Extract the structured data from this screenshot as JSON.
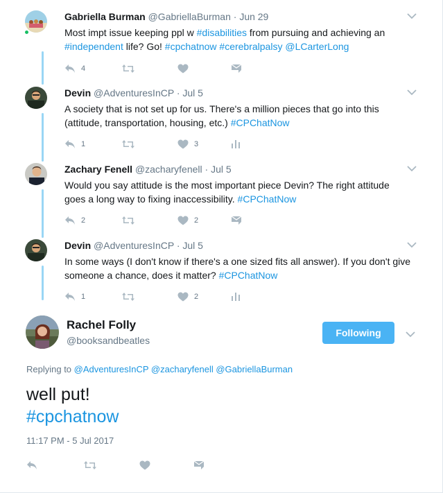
{
  "tweets": [
    {
      "name": "Gabriella Burman",
      "handle": "@GabriellaBurman",
      "dot": "·",
      "time": "Jun 29",
      "text": {
        "p1": "Most impt issue keeping ppl w ",
        "h1": "#disabilities",
        "p2": " from pursuing and achieving an ",
        "h2": "#independent",
        "p3": " life? Go! ",
        "h3": "#cpchatnow",
        "p4": " ",
        "h4": "#cerebralpalsy",
        "p5": " ",
        "h5": "@LCarterLong"
      },
      "reply_count": "4",
      "like_count": "",
      "last_action": "dm-icon"
    },
    {
      "name": "Devin",
      "handle": "@AdventuresInCP",
      "dot": "·",
      "time": "Jul 5",
      "text": {
        "p1": "A society that is not set up for us. There's a million pieces that go into this (attitude, transportation, housing, etc.) ",
        "h1": "#CPChatNow"
      },
      "reply_count": "1",
      "like_count": "3",
      "last_action": "analytics-icon"
    },
    {
      "name": "Zachary Fenell",
      "handle": "@zacharyfenell",
      "dot": "·",
      "time": "Jul 5",
      "text": {
        "p1": "Would you say attitude is the most important piece Devin? The right attitude goes a long way to fixing inaccessibility. ",
        "h1": "#CPChatNow"
      },
      "reply_count": "2",
      "like_count": "2",
      "last_action": "dm-icon"
    },
    {
      "name": "Devin",
      "handle": "@AdventuresInCP",
      "dot": "·",
      "time": "Jul 5",
      "text": {
        "p1": "In some ways (I don't know if there's a one sized fits all answer). If you don't give someone a chance, does it matter? ",
        "h1": "#CPChatNow"
      },
      "reply_count": "1",
      "like_count": "2",
      "last_action": "analytics-icon"
    }
  ],
  "main": {
    "name": "Rachel Folly",
    "handle": "@booksandbeatles",
    "follow_label": "Following",
    "replying_prefix": "Replying to",
    "replying": [
      "@AdventuresInCP",
      "@zacharyfenell",
      "@GabriellaBurman"
    ],
    "text_line1": "well put!",
    "text_line2": "#cpchatnow",
    "timestamp": "11:17 PM - 5 Jul 2017"
  },
  "colors": {
    "link": "#1b95e0",
    "follow_button": "#4ab3f4",
    "thread_line": "#99d6f5",
    "icon": "#aab8c2",
    "online": "#17bf63"
  }
}
